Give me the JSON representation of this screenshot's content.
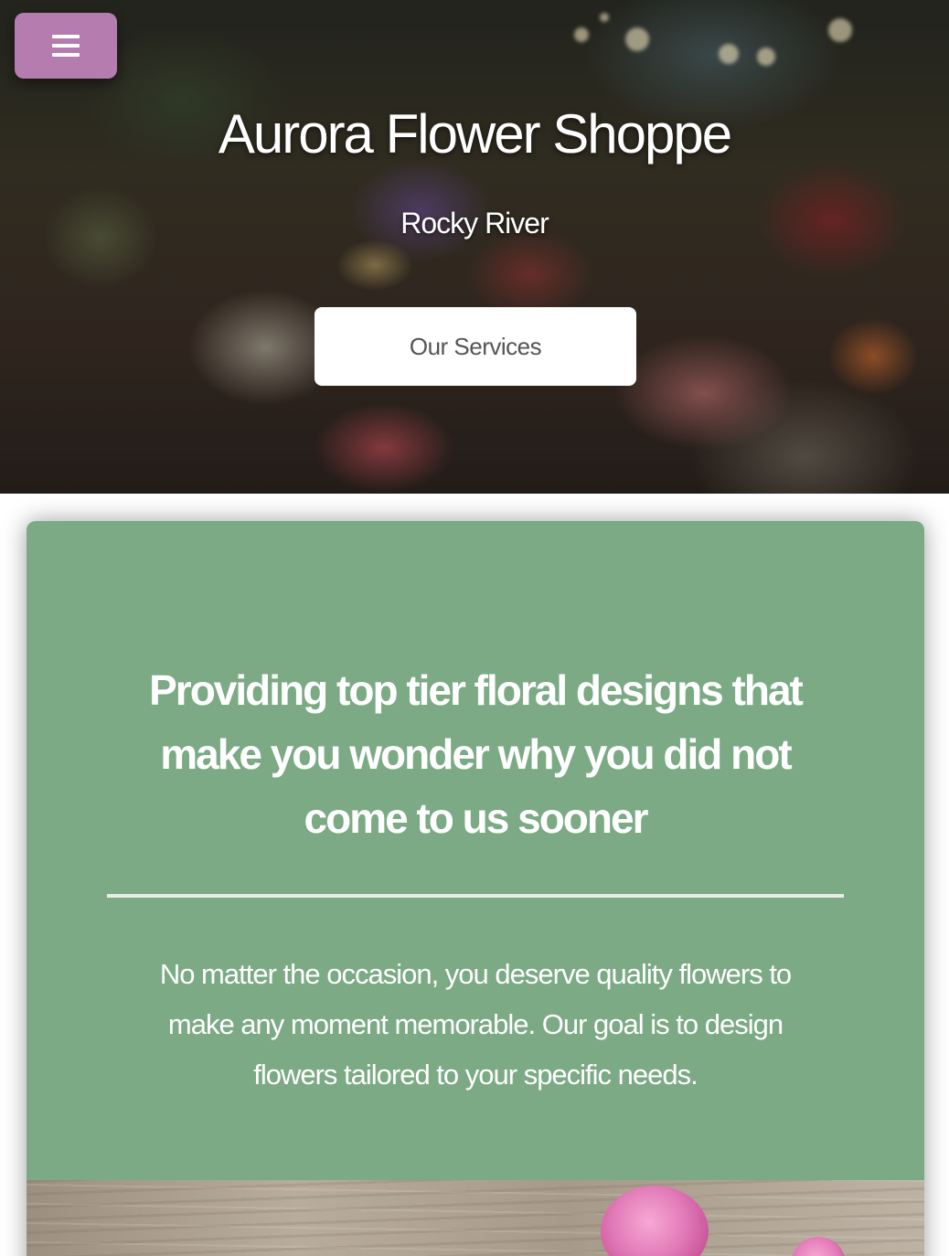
{
  "hero": {
    "title": "Aurora Flower Shoppe",
    "subtitle": "Rocky River",
    "cta_label": "Our Services"
  },
  "nav": {
    "menu_icon": "hamburger-icon"
  },
  "intro": {
    "heading": "Providing top tier floral designs that make you wonder why you did not come to us sooner",
    "body": "No matter the occasion, you deserve quality flowers to make any moment memorable. Our goal is to design flowers tailored to your specific needs."
  },
  "colors": {
    "menu_button": "#b57cb0",
    "card_background": "#7baa85",
    "button_background": "#ffffff",
    "button_text": "#555555",
    "heading_text": "#ffffff"
  }
}
